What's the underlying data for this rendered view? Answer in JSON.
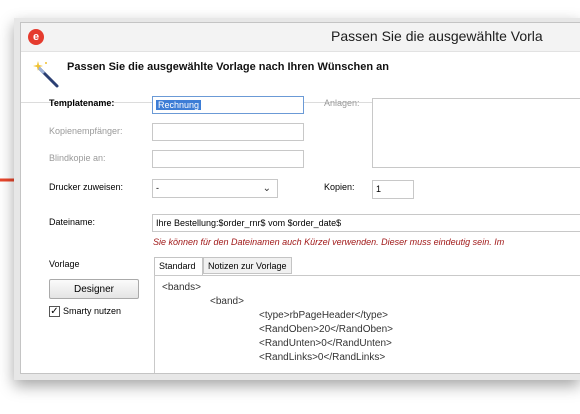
{
  "window": {
    "title": "Passen Sie die ausgewählte Vorla",
    "app_icon_letter": "e"
  },
  "header": {
    "text": "Passen Sie die ausgewählte Vorlage nach Ihren Wünschen an"
  },
  "form": {
    "templatename_label": "Templatename:",
    "templatename_value": "Rechnung",
    "kopien_empfaenger_label": "Kopienempfänger:",
    "blindkopie_label": "Blindkopie an:",
    "drucker_label": "Drucker zuweisen:",
    "drucker_value": "-",
    "kopien_label": "Kopien:",
    "kopien_value": "1",
    "anlagen_label": "Anlagen:",
    "dateiname_label": "Dateiname:",
    "dateiname_value": "Ihre Bestellung:$order_rnr$ vom $order_date$",
    "dateiname_hint": "Sie können für den Dateinamen auch Kürzel verwenden. Dieser muss eindeutig sein. Im",
    "vorlage_label": "Vorlage",
    "designer_button": "Designer",
    "smarty_label": "Smarty nutzen",
    "smarty_checked": true
  },
  "tabs": [
    {
      "label": "Standard",
      "active": true
    },
    {
      "label": "Notizen zur Vorlage",
      "active": false
    }
  ],
  "code_lines": [
    "<bands>",
    "<band>",
    "<type>rbPageHeader</type>",
    "<RandOben>20</RandOben>",
    "<RandUnten>0</RandUnten>",
    "<RandLinks>0</RandLinks>"
  ],
  "colors": {
    "accent": "#e53b2e",
    "selection": "#3d7dd6",
    "hint": "#a01818",
    "arrow": "#e8462c"
  }
}
